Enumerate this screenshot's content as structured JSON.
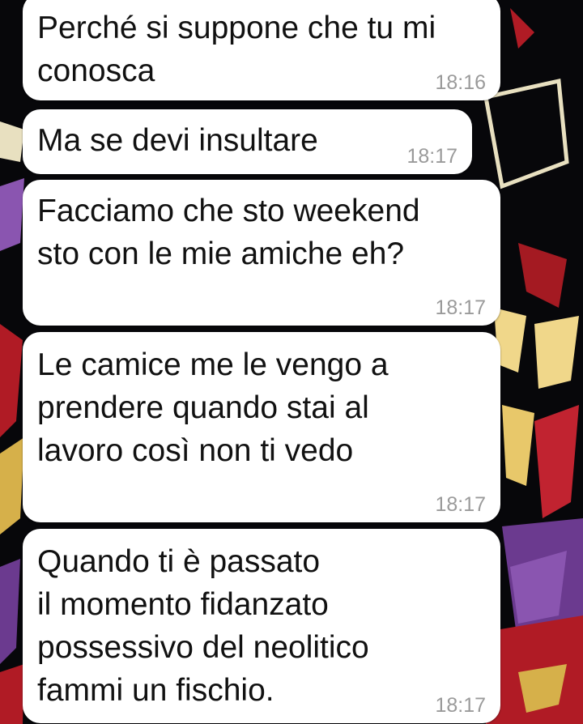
{
  "chat": {
    "messages": [
      {
        "text": "Perché si suppone che tu mi\nconosca",
        "time": "18:16"
      },
      {
        "text": "Ma se devi insultare",
        "time": "18:17"
      },
      {
        "text": "Facciamo che sto weekend\nsto con le mie amiche eh?",
        "time": "18:17"
      },
      {
        "text": "Le camice me le vengo a\nprendere quando stai al\nlavoro così non ti vedo",
        "time": "18:17"
      },
      {
        "text": "Quando ti è passato\nil momento fidanzato\npossessivo del neolitico\nfammi un fischio.",
        "time": "18:17"
      }
    ]
  },
  "theme": {
    "bubble_color": "#ffffff",
    "text_color": "#111111",
    "time_color": "#9a9a9a",
    "wallpaper_colors": [
      "#07070a",
      "#6b3a8f",
      "#f0e08a",
      "#c8202a"
    ]
  }
}
